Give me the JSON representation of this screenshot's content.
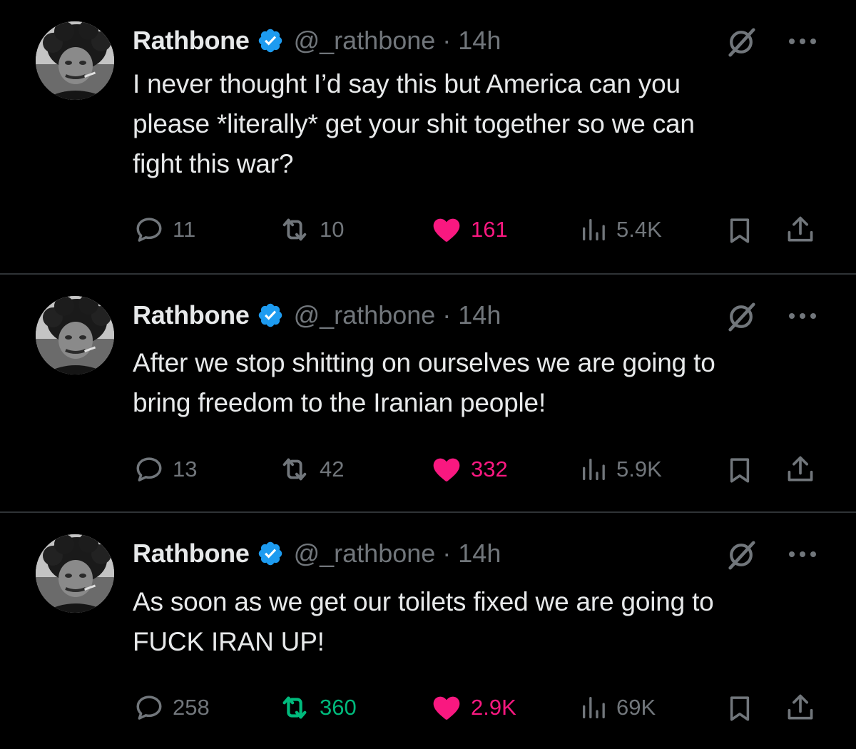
{
  "colors": {
    "background": "#000000",
    "text": "#e7e9ea",
    "muted": "#71767b",
    "verified": "#1d9bf0",
    "like": "#f91880",
    "retweet": "#00ba7c",
    "divider": "#2f3336"
  },
  "tweets": [
    {
      "display_name": "Rathbone",
      "handle": "@_rathbone",
      "separator": "·",
      "time": "14h",
      "text_lines": [
        "I never thought I’d say this but America can you",
        "please *literally* get your shit together so we can",
        "fight this war?"
      ],
      "replies": "11",
      "retweets": "10",
      "likes": "161",
      "views": "5.4K",
      "liked": true,
      "retweeted": false
    },
    {
      "display_name": "Rathbone",
      "handle": "@_rathbone",
      "separator": "·",
      "time": "14h",
      "text_lines": [
        "After we stop shitting on ourselves we are going to",
        "bring freedom to the Iranian people!"
      ],
      "replies": "13",
      "retweets": "42",
      "likes": "332",
      "views": "5.9K",
      "liked": true,
      "retweeted": false
    },
    {
      "display_name": "Rathbone",
      "handle": "@_rathbone",
      "separator": "·",
      "time": "14h",
      "text_lines": [
        "As soon as we get our toilets fixed we are going to",
        "FUCK IRAN UP!"
      ],
      "replies": "258",
      "retweets": "360",
      "likes": "2.9K",
      "views": "69K",
      "liked": true,
      "retweeted": true
    }
  ],
  "icons": {
    "verified": "verified-badge-icon",
    "grok": "grok-icon",
    "more": "more-options-icon",
    "reply": "reply-icon",
    "retweet": "retweet-icon",
    "like": "like-heart-icon",
    "views": "views-icon",
    "bookmark": "bookmark-icon",
    "share": "share-icon"
  }
}
